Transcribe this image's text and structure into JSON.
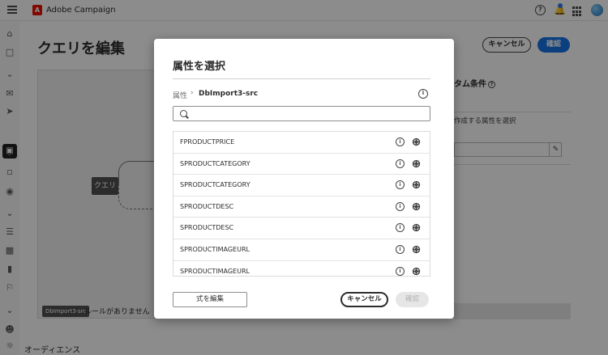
{
  "app": {
    "brand_name": "Adobe Campaign",
    "bottom_nav_label": "オーディエンス"
  },
  "editor": {
    "title": "クエリを編集",
    "cancel_label": "キャンセル",
    "confirm_label": "確認",
    "query_node_label": "クエリ",
    "source_badge": "DbImport3-src",
    "no_rules_text": "ルールがありません",
    "custom_condition_title": "タム条件",
    "attribute_hint": "作成する属性を選択"
  },
  "modal": {
    "title": "属性を選択",
    "breadcrumb_root": "属性",
    "breadcrumb_separator": "›",
    "breadcrumb_current": "DbImport3-src",
    "search_placeholder": "",
    "search_value": "",
    "attributes": [
      "FPRODUCTPRICE",
      "SPRODUCTCATEGORY",
      "SPRODUCTCATEGORY",
      "SPRODUCTDESC",
      "SPRODUCTDESC",
      "SPRODUCTIMAGEURL",
      "SPRODUCTIMAGEURL"
    ],
    "edit_expression_label": "式を編集",
    "cancel_label": "キャンセル",
    "confirm_label": "確認"
  },
  "colors": {
    "accent": "#1473e6",
    "brand": "#eb1000",
    "overlay": "rgba(0,0,0,0.45)"
  },
  "icons": {
    "info": "i",
    "search": "search-icon"
  }
}
